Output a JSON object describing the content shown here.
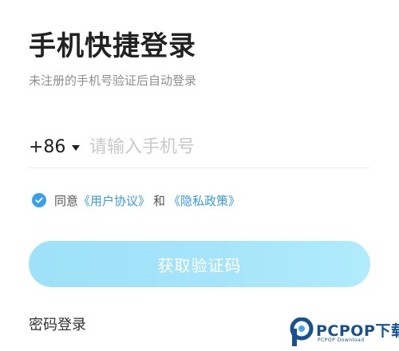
{
  "header": {
    "title": "手机快捷登录",
    "subtitle": "未注册的手机号验证后自动登录"
  },
  "phone": {
    "country_code": "+86",
    "placeholder": "请输入手机号",
    "value": ""
  },
  "agreement": {
    "checked": true,
    "prefix": "同意",
    "user_agreement": "《用户协议》",
    "conjunction": "和",
    "privacy_policy": "《隐私政策》"
  },
  "actions": {
    "get_code_label": "获取验证码",
    "password_login_label": "密码登录"
  },
  "watermark": {
    "name": "PCPOP下载",
    "sub": "PCPOP Download"
  },
  "colors": {
    "accent": "#3a9bdc",
    "button_gradient_start": "#9ee1f8",
    "button_gradient_end": "#b0ecfb",
    "watermark": "#17518f"
  },
  "icons": {
    "country_dropdown": "caret-down-icon",
    "agreement_check": "check-circle-icon",
    "watermark_logo": "pcpop-logo-icon"
  }
}
